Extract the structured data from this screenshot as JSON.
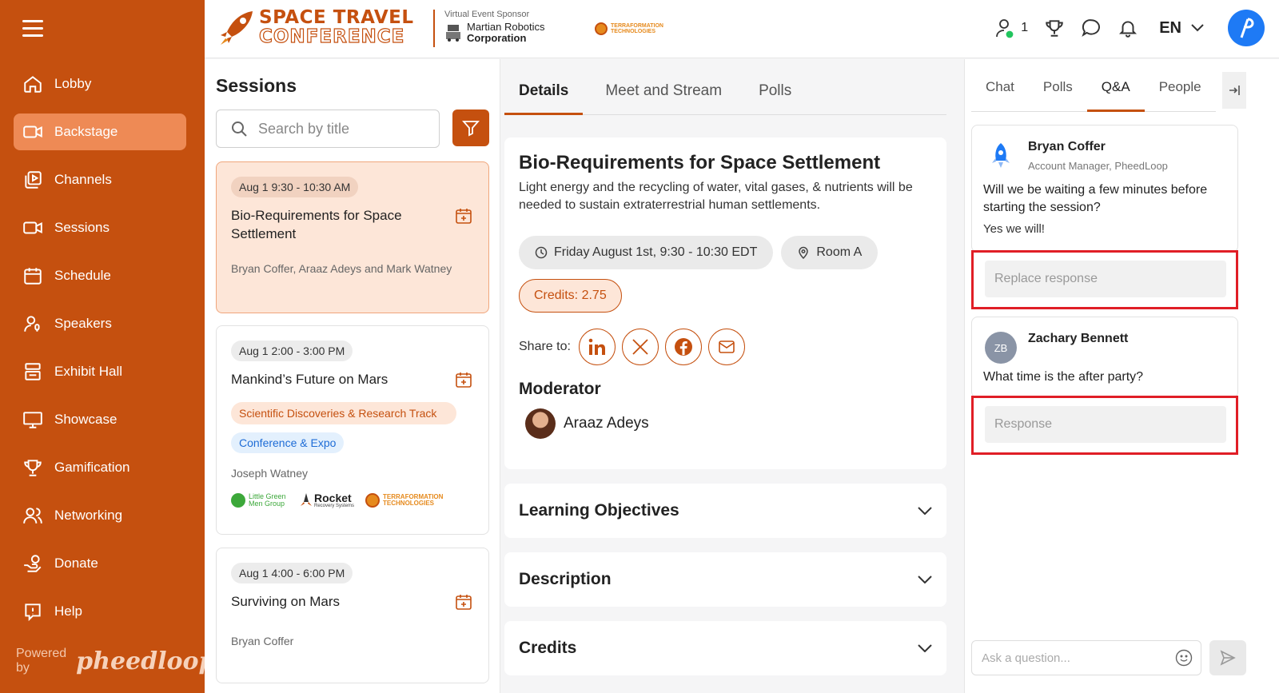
{
  "sidebar": {
    "items": [
      {
        "label": "Lobby",
        "icon": "home-icon"
      },
      {
        "label": "Backstage",
        "icon": "video-camera-icon",
        "active": true
      },
      {
        "label": "Channels",
        "icon": "channels-icon"
      },
      {
        "label": "Sessions",
        "icon": "video-camera-icon"
      },
      {
        "label": "Schedule",
        "icon": "calendar-icon"
      },
      {
        "label": "Speakers",
        "icon": "speaker-icon"
      },
      {
        "label": "Exhibit Hall",
        "icon": "booth-icon"
      },
      {
        "label": "Showcase",
        "icon": "presentation-icon"
      },
      {
        "label": "Gamification",
        "icon": "trophy-icon"
      },
      {
        "label": "Networking",
        "icon": "people-icon"
      },
      {
        "label": "Donate",
        "icon": "donate-icon"
      },
      {
        "label": "Help",
        "icon": "help-icon"
      }
    ],
    "powered_by": "Powered by",
    "powered_logo": "pheedloop"
  },
  "header": {
    "brand_line1": "SPACE TRAVEL",
    "brand_line2": "CONFERENCE",
    "sponsor_caption": "Virtual Event Sponsor",
    "sponsor_name1": "Martian Robotics",
    "sponsor_name2": "Corporation",
    "terra_logo": "TERRAFORMATION TECHNOLOGIES",
    "attendee_count": "1",
    "language": "EN"
  },
  "sessions": {
    "title": "Sessions",
    "search_placeholder": "Search by title",
    "cards": [
      {
        "time": "Aug 1 9:30 - 10:30 AM",
        "title": "Bio-Requirements for Space Settlement",
        "people": "Bryan Coffer, Araaz Adeys and Mark Watney"
      },
      {
        "time": "Aug 1 2:00 - 3:00 PM",
        "title": "Mankind’s Future on Mars",
        "track": "Scientific Discoveries & Research Track",
        "tag": "Conference & Expo",
        "people": "Joseph Watney",
        "logo1": "Little Green Men Group",
        "logo2": "Rocket",
        "logo2_sub": "Recovery Systems",
        "logo3": "TERRAFORMATION TECHNOLOGIES"
      },
      {
        "time": "Aug 1 4:00 - 6:00 PM",
        "title": "Surviving on Mars",
        "people": "Bryan Coffer"
      }
    ]
  },
  "details": {
    "tabs": [
      "Details",
      "Meet and Stream",
      "Polls"
    ],
    "title": "Bio-Requirements for Space Settlement",
    "description": "Light energy and the recycling of water, vital gases, & nutrients will be needed to sustain extraterrestrial human settlements.",
    "datetime": "Friday August 1st, 9:30 - 10:30 EDT",
    "room": "Room A",
    "credits": "Credits: 2.75",
    "share_label": "Share to:",
    "moderator_heading": "Moderator",
    "moderator_name": "Araaz Adeys",
    "accordions": [
      "Learning Objectives",
      "Description",
      "Credits"
    ]
  },
  "qa": {
    "tabs": [
      "Chat",
      "Polls",
      "Q&A",
      "People"
    ],
    "questions": [
      {
        "name": "Bryan Coffer",
        "role": "Account Manager, PheedLoop",
        "text": "Will we be waiting a few minutes before starting the session?",
        "answer": "Yes we will!",
        "response_placeholder": "Replace response"
      },
      {
        "name": "Zachary Bennett",
        "initials": "ZB",
        "text": "What time is the after party?",
        "response_placeholder": "Response"
      }
    ],
    "ask_placeholder": "Ask a question..."
  },
  "colors": {
    "brand": "#c5500f",
    "active_nav": "#ee8a55",
    "highlight": "#e01e26",
    "link_blue": "#1e6cd6"
  }
}
